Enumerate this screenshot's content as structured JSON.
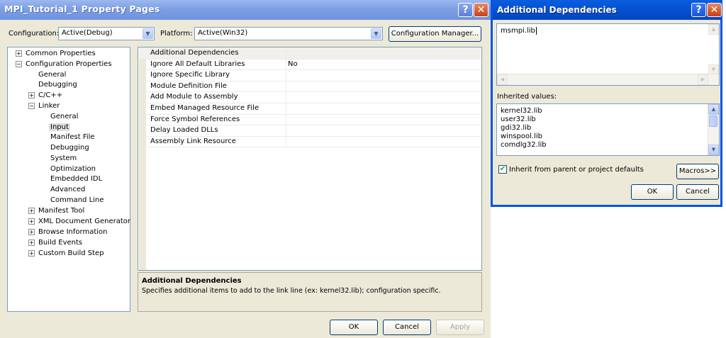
{
  "main_window": {
    "title": "MPI_Tutorial_1 Property Pages",
    "help_glyph": "?",
    "close_glyph": "✕",
    "configuration_label": "Configuration:",
    "configuration_value": "Active(Debug)",
    "platform_label": "Platform:",
    "platform_value": "Active(Win32)",
    "configuration_manager_label": "Configuration Manager...",
    "tree": [
      {
        "label": "Common Properties",
        "expander": "+"
      },
      {
        "label": "Configuration Properties",
        "expander": "−"
      },
      {
        "label": "General"
      },
      {
        "label": "Debugging"
      },
      {
        "label": "C/C++",
        "expander": "+"
      },
      {
        "label": "Linker",
        "expander": "−"
      },
      {
        "label": "General"
      },
      {
        "label": "Input"
      },
      {
        "label": "Manifest File"
      },
      {
        "label": "Debugging"
      },
      {
        "label": "System"
      },
      {
        "label": "Optimization"
      },
      {
        "label": "Embedded IDL"
      },
      {
        "label": "Advanced"
      },
      {
        "label": "Command Line"
      },
      {
        "label": "Manifest Tool",
        "expander": "+"
      },
      {
        "label": "XML Document Generator",
        "expander": "+"
      },
      {
        "label": "Browse Information",
        "expander": "+"
      },
      {
        "label": "Build Events",
        "expander": "+"
      },
      {
        "label": "Custom Build Step",
        "expander": "+"
      }
    ],
    "properties": [
      {
        "name": "Additional Dependencies",
        "value": ""
      },
      {
        "name": "Ignore All Default Libraries",
        "value": "No"
      },
      {
        "name": "Ignore Specific Library",
        "value": ""
      },
      {
        "name": "Module Definition File",
        "value": ""
      },
      {
        "name": "Add Module to Assembly",
        "value": ""
      },
      {
        "name": "Embed Managed Resource File",
        "value": ""
      },
      {
        "name": "Force Symbol References",
        "value": ""
      },
      {
        "name": "Delay Loaded DLLs",
        "value": ""
      },
      {
        "name": "Assembly Link Resource",
        "value": ""
      }
    ],
    "description": {
      "title": "Additional Dependencies",
      "text": "Specifies additional items to add to the link line (ex: kernel32.lib); configuration specific."
    },
    "buttons": {
      "ok": "OK",
      "cancel": "Cancel",
      "apply": "Apply"
    }
  },
  "dependencies_dialog": {
    "title": "Additional Dependencies",
    "help_glyph": "?",
    "close_glyph": "✕",
    "input_value": "msmpi.lib",
    "inherited_label": "Inherited values:",
    "inherited_values": [
      "kernel32.lib",
      "user32.lib",
      "gdi32.lib",
      "winspool.lib",
      "comdlg32.lib"
    ],
    "inherit_checkbox_label": "Inherit from parent or project defaults",
    "inherit_checked": true,
    "check_glyph": "✔",
    "macros_label": "Macros>>",
    "ok_label": "OK",
    "cancel_label": "Cancel"
  },
  "icons": {
    "scroll_up": "▲",
    "scroll_down": "▼",
    "scroll_left": "◀",
    "scroll_right": "▶",
    "dropdown": "▼"
  }
}
